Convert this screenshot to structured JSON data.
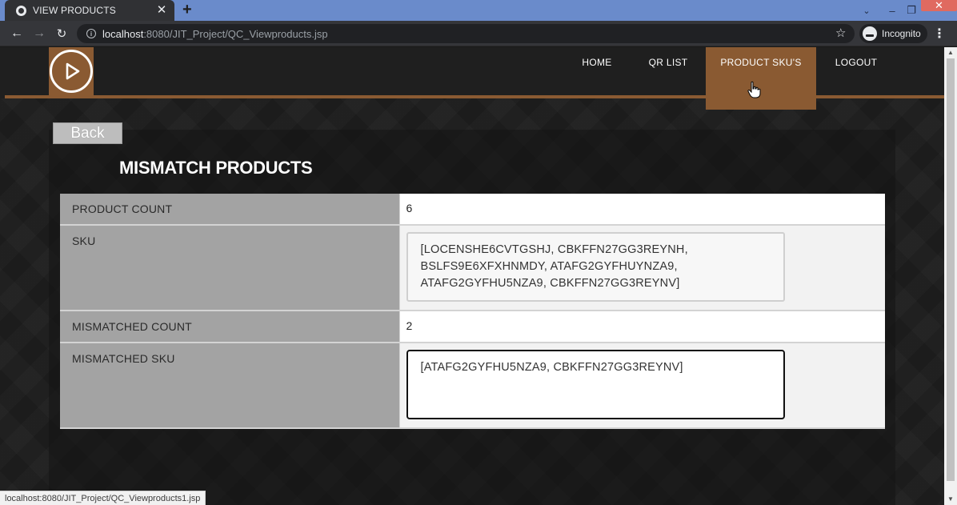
{
  "browser": {
    "tab_title": "VIEW PRODUCTS",
    "tab_close": "✕",
    "new_tab": "+",
    "url_host": "localhost",
    "url_path": ":8080/JIT_Project/QC_Viewproducts.jsp",
    "profile": "Incognito",
    "status_url": "localhost:8080/JIT_Project/QC_Viewproducts1.jsp"
  },
  "nav": {
    "items": [
      {
        "label": "HOME"
      },
      {
        "label": "QR LIST"
      },
      {
        "label": "PRODUCT SKU'S",
        "active": true
      },
      {
        "label": "LOGOUT"
      }
    ]
  },
  "page": {
    "back_label": "Back",
    "title": "MISMATCH PRODUCTS"
  },
  "table": {
    "product_count_label": "PRODUCT COUNT",
    "product_count_value": "6",
    "sku_label": "SKU",
    "sku_value": "[LOCENSHE6CVTGSHJ, CBKFFN27GG3REYNH, BSLFS9E6XFXHNMDY, ATAFG2GYFHUYNZA9, ATAFG2GYFHU5NZA9, CBKFFN27GG3REYNV]",
    "mismatched_count_label": "MISMATCHED COUNT",
    "mismatched_count_value": "2",
    "mismatched_sku_label": "MISMATCHED SKU",
    "mismatched_sku_value": "[ATAFG2GYFHU5NZA9, CBKFFN27GG3REYNV]"
  },
  "colors": {
    "accent": "#8a5a32",
    "header_bg": "#1f1f1f",
    "label_cell": "#a3a3a3"
  }
}
